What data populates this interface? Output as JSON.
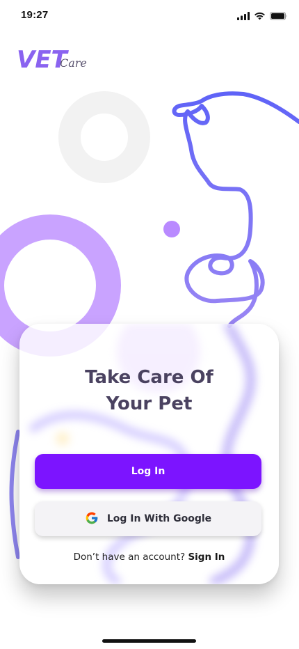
{
  "status_bar": {
    "time": "19:27"
  },
  "logo": {
    "main": "VET",
    "sub": "Care"
  },
  "card": {
    "headline_line1": "Take Care Of",
    "headline_line2": "Your Pet",
    "login_label": "Log In",
    "google_label": "Log In With Google",
    "signup_prompt": "Don’t have an account?",
    "signup_link": "Sign In"
  },
  "colors": {
    "brand_purple": "#7c14ff",
    "logo_purple": "#8a63f0",
    "heading": "#4a4260",
    "decor_lilac": "#c9a3ff",
    "decor_gray": "#f2f2f2",
    "line_blue": "#6b63f5"
  },
  "icons": [
    "cellular-signal-icon",
    "wifi-icon",
    "battery-icon",
    "google-icon"
  ]
}
